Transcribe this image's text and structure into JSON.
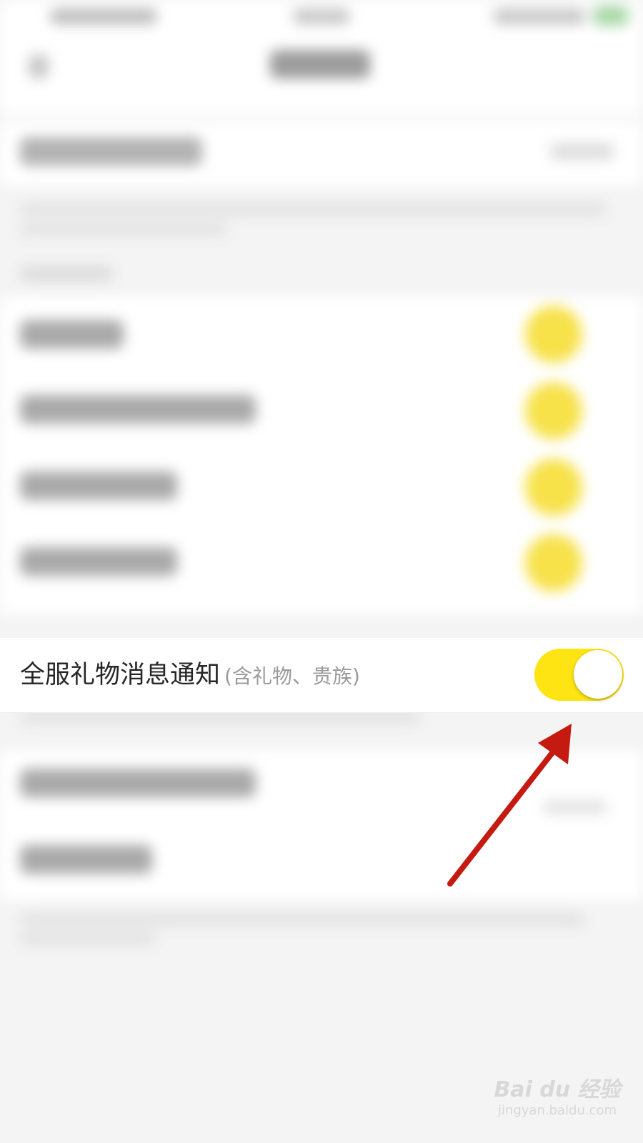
{
  "focused_setting": {
    "title": "全服礼物消息通知",
    "subtitle": "(含礼物、贵族)",
    "enabled": true
  },
  "colors": {
    "toggle_on": "#ffe413",
    "annotation_arrow": "#c41a10"
  },
  "watermark": {
    "brand": "Bai du 经验",
    "url": "jingyan.baidu.com"
  }
}
